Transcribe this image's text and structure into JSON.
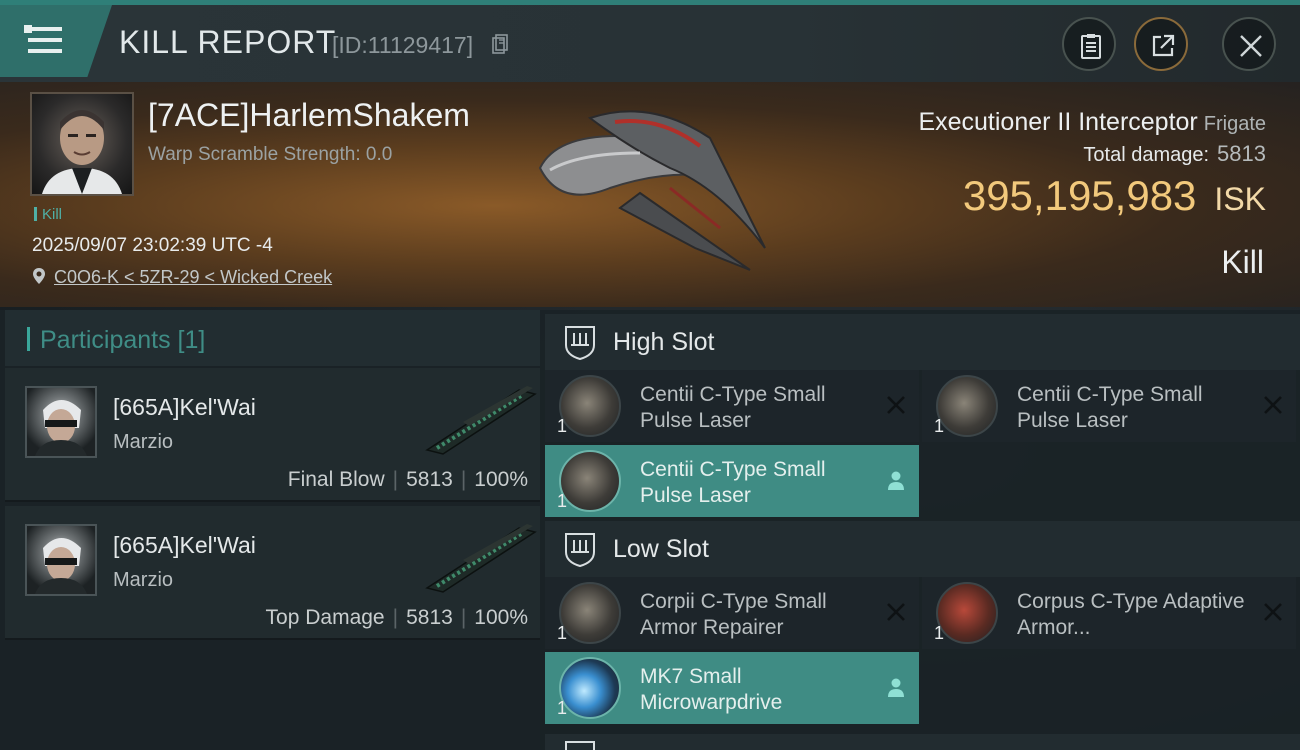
{
  "header": {
    "title": "KILL REPORT",
    "report_id": "[ID:11129417]",
    "icons": [
      "menu-icon",
      "copy-icon",
      "clipboard-icon",
      "share-icon",
      "close-icon"
    ]
  },
  "victim": {
    "name": "[7ACE]HarlemShakem",
    "warp_scramble": "Warp Scramble Strength: 0.0",
    "tag": "Kill",
    "datetime": "2025/09/07 23:02:39 UTC -4",
    "location": "C0O6-K < 5ZR-29 < Wicked Creek",
    "ship_name": "Executioner II Interceptor",
    "ship_class": "Frigate",
    "total_damage_label": "Total damage:",
    "total_damage": "5813",
    "isk_value": "395,195,983",
    "isk_unit": "ISK",
    "result": "Kill"
  },
  "participants": {
    "header": "Participants [1]",
    "cards": [
      {
        "name": "[665A]Kel'Wai",
        "ship": "Marzio",
        "role": "Final Blow",
        "damage": "5813",
        "percent": "100%"
      },
      {
        "name": "[665A]Kel'Wai",
        "ship": "Marzio",
        "role": "Top Damage",
        "damage": "5813",
        "percent": "100%"
      }
    ]
  },
  "fitting": {
    "high_slot": {
      "label": "High Slot",
      "modules": [
        {
          "name": "Centii C-Type Small Pulse Laser",
          "qty": "1",
          "status": "destroyed"
        },
        {
          "name": "Centii C-Type Small Pulse Laser",
          "qty": "1",
          "status": "destroyed"
        },
        {
          "name": "Centii C-Type Small Pulse Laser",
          "qty": "1",
          "status": "dropped"
        }
      ]
    },
    "low_slot": {
      "label": "Low Slot",
      "modules": [
        {
          "name": "Corpii C-Type Small Armor Repairer",
          "qty": "1",
          "status": "destroyed"
        },
        {
          "name": "Corpus C-Type Adaptive Armor...",
          "qty": "1",
          "status": "destroyed"
        },
        {
          "name": "MK7 Small Microwarpdrive",
          "qty": "1",
          "status": "dropped"
        }
      ]
    }
  }
}
